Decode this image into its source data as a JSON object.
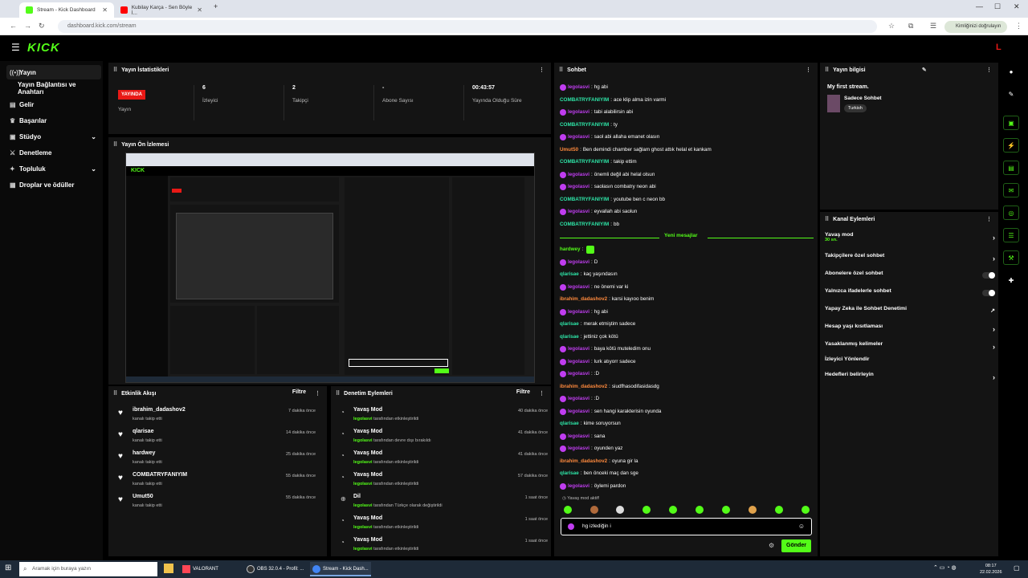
{
  "browser": {
    "tabs": [
      {
        "title": "Stream - Kick Dashboard",
        "active": true
      },
      {
        "title": "Kubilay Karça - Sen Böyle İ...",
        "active": false
      }
    ],
    "url_host": "dashboard.kick.com",
    "url_path": "/stream",
    "profile_label": "Kimliğinizi doğrulayın"
  },
  "kick": {
    "logo": "KICK",
    "avatar_letter": "L"
  },
  "sidebar": {
    "items": [
      {
        "label": "Yayın",
        "icon": "stream-icon"
      },
      {
        "label": "Yayın Bağlantısı ve Anahtarı",
        "icon": ""
      },
      {
        "label": "Gelir",
        "icon": "revenue-icon"
      },
      {
        "label": "Başarılar",
        "icon": "achievements-icon"
      },
      {
        "label": "Stüdyo",
        "icon": "studio-icon"
      },
      {
        "label": "Denetleme",
        "icon": "moderation-icon"
      },
      {
        "label": "Topluluk",
        "icon": "community-icon"
      },
      {
        "label": "Droplar ve ödüller",
        "icon": "drops-icon"
      }
    ]
  },
  "stats": {
    "title": "Yayın İstatistikleri",
    "live_badge": "YAYINDA",
    "live_label": "Yayın",
    "viewers": "6",
    "viewers_label": "İzleyici",
    "followers": "2",
    "followers_label": "Takipçi",
    "subs": "-",
    "subs_label": "Abone Sayısı",
    "uptime": "00:43:57",
    "uptime_label": "Yayında Olduğu Süre"
  },
  "preview": {
    "title": "Yayın Ön İzlemesi"
  },
  "activity": {
    "title": "Etkinlik Akışı",
    "filter": "Filtre",
    "items": [
      {
        "name": "ibrahim_dadashov2",
        "sub": "kanalı takip etti",
        "time": "7 dakika önce"
      },
      {
        "name": "qlarisae",
        "sub": "kanalı takip etti",
        "time": "14 dakika önce"
      },
      {
        "name": "hardwey",
        "sub": "kanalı takip etti",
        "time": "25 dakika önce"
      },
      {
        "name": "COMBATRYFANIYIM",
        "sub": "kanalı takip etti",
        "time": "55 dakika önce"
      },
      {
        "name": "Umut50",
        "sub": "kanalı takip etti",
        "time": "55 dakika önce"
      }
    ]
  },
  "modactions": {
    "title": "Denetim Eylemleri",
    "filter": "Filtre",
    "items": [
      {
        "name": "Yavaş Mod",
        "user": "legolasvi",
        "rest": " tarafından etkinleştirildi",
        "time": "40 dakika önce"
      },
      {
        "name": "Yavaş Mod",
        "user": "legolasvi",
        "rest": " tarafından devre dışı bırakıldı",
        "time": "41 dakika önce"
      },
      {
        "name": "Yavaş Mod",
        "user": "legolasvi",
        "rest": " tarafından etkinleştirildi",
        "time": "41 dakika önce"
      },
      {
        "name": "Yavaş Mod",
        "user": "legolasvi",
        "rest": " tarafından etkinleştirildi",
        "time": "57 dakika önce"
      },
      {
        "name": "Dil",
        "user": "legolasvi",
        "rest": " tarafından Türkçe olarak değiştirildi",
        "time": "1 saat önce"
      },
      {
        "name": "Yavaş Mod",
        "user": "legolasvi",
        "rest": " tarafından etkinleştirildi",
        "time": "1 saat önce"
      },
      {
        "name": "Yavaş Mod",
        "user": "legolasvi",
        "rest": " tarafından etkinleştirildi",
        "time": "1 saat önce"
      }
    ]
  },
  "chat": {
    "title": "Sohbet",
    "new_messages": "Yeni mesajlar",
    "slow_mode_note": "Yavaş mod aktif!",
    "input_value": "hg izlediğin i",
    "send": "Gönder",
    "colors": {
      "owner": "#c03df0",
      "green": "#53fc18",
      "orange": "#ff8a3d",
      "teal": "#2ee6a8"
    },
    "messages": [
      {
        "user": "legolasvi",
        "text": "hg abi",
        "color": "#c03df0",
        "badge": true
      },
      {
        "user": "COMBATRYFANIYIM",
        "text": "ace klip alma izin varmi",
        "color": "#2ee6a8",
        "badge": false
      },
      {
        "user": "legolasvi",
        "text": "tabi alabilirsin abi",
        "color": "#c03df0",
        "badge": true
      },
      {
        "user": "COMBATRYFANIYIM",
        "text": "ty",
        "color": "#2ee6a8",
        "badge": false
      },
      {
        "user": "legolasvi",
        "text": "saol abi allaha emanet olasın",
        "color": "#c03df0",
        "badge": true
      },
      {
        "user": "Umut50",
        "text": "Ben demindi chamber sağlam ghost attık helal et kankam",
        "color": "#ff8a3d",
        "badge": false
      },
      {
        "user": "COMBATRYFANIYIM",
        "text": "takip ettim",
        "color": "#2ee6a8",
        "badge": false
      },
      {
        "user": "legolasvi",
        "text": "önemli değil abi helal olsun",
        "color": "#c03df0",
        "badge": true
      },
      {
        "user": "legolasvi",
        "text": "saolasın combatry neon abi",
        "color": "#c03df0",
        "badge": true
      },
      {
        "user": "COMBATRYFANIYIM",
        "text": "youtube ben c neon bb",
        "color": "#2ee6a8",
        "badge": false
      },
      {
        "user": "legolasvi",
        "text": "eyvallah abi saolun",
        "color": "#c03df0",
        "badge": true
      },
      {
        "user": "COMBATRYFANIYIM",
        "text": "bb",
        "color": "#2ee6a8",
        "badge": false
      }
    ],
    "messages2": [
      {
        "user": "hardwey",
        "text": "",
        "color": "#53fc18",
        "badge": false
      },
      {
        "user": "legolasvi",
        "text": "D",
        "color": "#c03df0",
        "badge": true
      },
      {
        "user": "qlarisae",
        "text": "kaç yaşındasın",
        "color": "#2ee6a8",
        "badge": false
      },
      {
        "user": "legolasvi",
        "text": "ne önemi var ki",
        "color": "#c03df0",
        "badge": true
      },
      {
        "user": "ibrahim_dadashov2",
        "text": "karsi kayıoo benim",
        "color": "#ff8a3d",
        "badge": false
      },
      {
        "user": "legolasvi",
        "text": "hg abi",
        "color": "#c03df0",
        "badge": true
      },
      {
        "user": "qlarisae",
        "text": "merak etmiştim sadece",
        "color": "#2ee6a8",
        "badge": false
      },
      {
        "user": "qlarisae",
        "text": "jettiniz çok kötü",
        "color": "#2ee6a8",
        "badge": false
      },
      {
        "user": "legolasvi",
        "text": "bayа kötü muteledim onu",
        "color": "#c03df0",
        "badge": true
      },
      {
        "user": "legolasvi",
        "text": "lurk atıyorr sadece",
        "color": "#c03df0",
        "badge": true
      },
      {
        "user": "legolasvi",
        "text": ":D",
        "color": "#c03df0",
        "badge": true
      },
      {
        "user": "ibrahim_dadashov2",
        "text": "siudfhasodifasidasdg",
        "color": "#ff8a3d",
        "badge": false
      },
      {
        "user": "legolasvi",
        "text": ":D",
        "color": "#c03df0",
        "badge": true
      },
      {
        "user": "legolasvi",
        "text": "sen hangi karakterisin oyunda",
        "color": "#c03df0",
        "badge": true
      },
      {
        "user": "qlarisae",
        "text": "kime soruyorsun",
        "color": "#2ee6a8",
        "badge": false
      },
      {
        "user": "legolasvi",
        "text": "sana",
        "color": "#c03df0",
        "badge": true
      },
      {
        "user": "legolasvi",
        "text": "oyunden yaz",
        "color": "#c03df0",
        "badge": true
      },
      {
        "user": "ibrahim_dadashov2",
        "text": "oyuna gir la",
        "color": "#ff8a3d",
        "badge": false
      },
      {
        "user": "qlarisae",
        "text": "ben önceki maç dan sge",
        "color": "#2ee6a8",
        "badge": false
      },
      {
        "user": "legolasvi",
        "text": "öylemi pardon",
        "color": "#c03df0",
        "badge": true
      }
    ]
  },
  "info": {
    "title": "Yayın bilgisi",
    "stream_title": "My first stream.",
    "category": "Sadece Sohbet",
    "language": "Turkish"
  },
  "channel_actions": {
    "title": "Kanal Eylemleri",
    "items": [
      {
        "label": "Yavaş mod",
        "sub": "30 sn.",
        "ctrl": "chevron"
      },
      {
        "label": "Takipçilere özel sohbet",
        "sub": "",
        "ctrl": "chevron"
      },
      {
        "label": "Abonelere özel sohbet",
        "sub": "",
        "ctrl": "toggle"
      },
      {
        "label": "Yalnızca ifadelerle sohbet",
        "sub": "",
        "ctrl": "toggle"
      },
      {
        "label": "Yapay Zeka ile Sohbet Denetimi",
        "sub": "",
        "ctrl": "external"
      },
      {
        "label": "Hesap yaşı kısıtlaması",
        "sub": "",
        "ctrl": "chevron"
      },
      {
        "label": "Yasaklanmış kelimeler",
        "sub": "",
        "ctrl": "chevron"
      },
      {
        "label": "İzleyici Yönlendir",
        "sub": "",
        "ctrl": "none"
      },
      {
        "label": "Hedefleri belirleyin",
        "sub": "",
        "ctrl": "chevron"
      }
    ]
  },
  "taskbar": {
    "search": "Aramak için buraya yazın",
    "apps": [
      "VALORANT",
      "OBS 32.0.4 - Profil: ...",
      "Stream - Kick Dash..."
    ],
    "time": "08:17",
    "date": "22.02.2026"
  }
}
